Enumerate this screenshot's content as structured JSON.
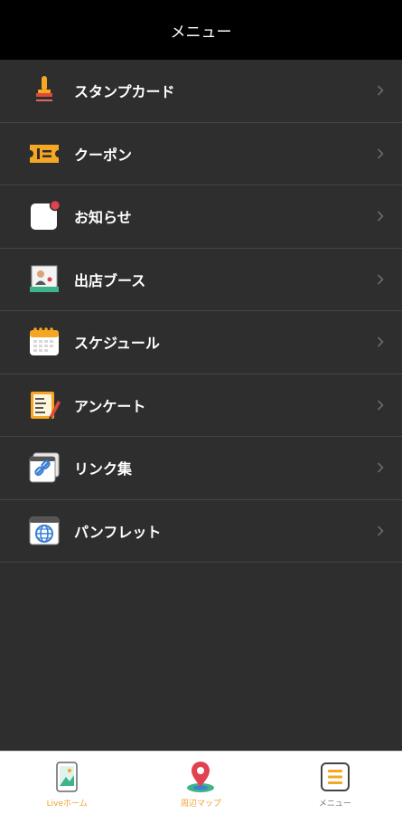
{
  "header": {
    "title": "メニュー"
  },
  "menu": {
    "items": [
      {
        "label": "スタンプカード",
        "icon": "stamp-icon"
      },
      {
        "label": "クーポン",
        "icon": "coupon-icon"
      },
      {
        "label": "お知らせ",
        "icon": "notification-icon"
      },
      {
        "label": "出店ブース",
        "icon": "booth-icon"
      },
      {
        "label": "スケジュール",
        "icon": "calendar-icon"
      },
      {
        "label": "アンケート",
        "icon": "survey-icon"
      },
      {
        "label": "リンク集",
        "icon": "link-icon"
      },
      {
        "label": "パンフレット",
        "icon": "globe-icon"
      }
    ]
  },
  "tabbar": {
    "tabs": [
      {
        "label": "Liveホーム",
        "icon": "home-photo-icon",
        "color": "#f0a030"
      },
      {
        "label": "周辺マップ",
        "icon": "map-pin-icon",
        "color": "#f0a030"
      },
      {
        "label": "メニュー",
        "icon": "menu-icon",
        "color": "#777777"
      }
    ]
  },
  "colors": {
    "accent": "#f5a623",
    "background": "#2e2e2e",
    "header": "#000000"
  }
}
